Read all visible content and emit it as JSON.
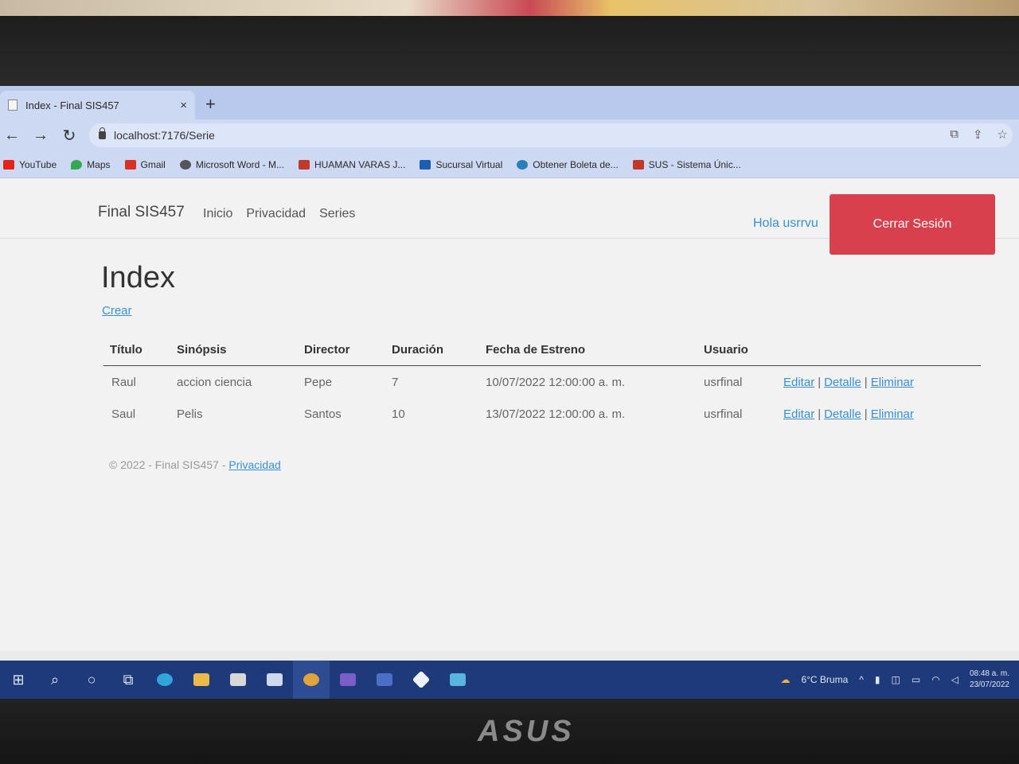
{
  "browser": {
    "tab_title": "Index - Final SIS457",
    "tab_close": "×",
    "new_tab": "+",
    "back": "←",
    "forward": "→",
    "reload": "↻",
    "url": "localhost:7176/Serie"
  },
  "bookmarks": [
    {
      "label": "YouTube",
      "icon": "youtube-icon",
      "color": "#e62117"
    },
    {
      "label": "Maps",
      "icon": "maps-icon",
      "color": "#34a853"
    },
    {
      "label": "Gmail",
      "icon": "gmail-icon",
      "color": "#d93025"
    },
    {
      "label": "Microsoft Word - M...",
      "icon": "globe-icon",
      "color": "#555555"
    },
    {
      "label": "HUAMAN VARAS J...",
      "icon": "bookmark-icon",
      "color": "#c0392b"
    },
    {
      "label": "Sucursal Virtual",
      "icon": "bank-icon",
      "color": "#1a5fb4"
    },
    {
      "label": "Obtener Boleta de...",
      "icon": "gear-icon",
      "color": "#2980b9"
    },
    {
      "label": "SUS - Sistema Únic...",
      "icon": "sus-icon",
      "color": "#c0392b"
    }
  ],
  "site": {
    "brand": "Final SIS457",
    "nav": [
      "Inicio",
      "Privacidad",
      "Series"
    ],
    "hello": "Hola usrrvu",
    "logout": "Cerrar Sesión"
  },
  "main": {
    "title": "Index",
    "create": "Crear",
    "columns": [
      "Título",
      "Sinópsis",
      "Director",
      "Duración",
      "Fecha de Estreno",
      "Usuario"
    ],
    "rows": [
      {
        "titulo": "Raul",
        "sinopsis": "accion ciencia",
        "director": "Pepe",
        "duracion": "7",
        "fecha": "10/07/2022 12:00:00 a. m.",
        "usuario": "usrfinal"
      },
      {
        "titulo": "Saul",
        "sinopsis": "Pelis",
        "director": "Santos",
        "duracion": "10",
        "fecha": "13/07/2022 12:00:00 a. m.",
        "usuario": "usrfinal"
      }
    ],
    "actions": {
      "edit": "Editar",
      "detail": "Detalle",
      "delete": "Eliminar",
      "separator": "|"
    }
  },
  "footer": {
    "text": "© 2022 - Final SIS457 -",
    "link": "Privacidad"
  },
  "taskbar": {
    "weather": "6°C  Bruma",
    "time": "08:48 a. m.",
    "date": "23/07/2022"
  },
  "device": {
    "brand": "ASUS"
  }
}
